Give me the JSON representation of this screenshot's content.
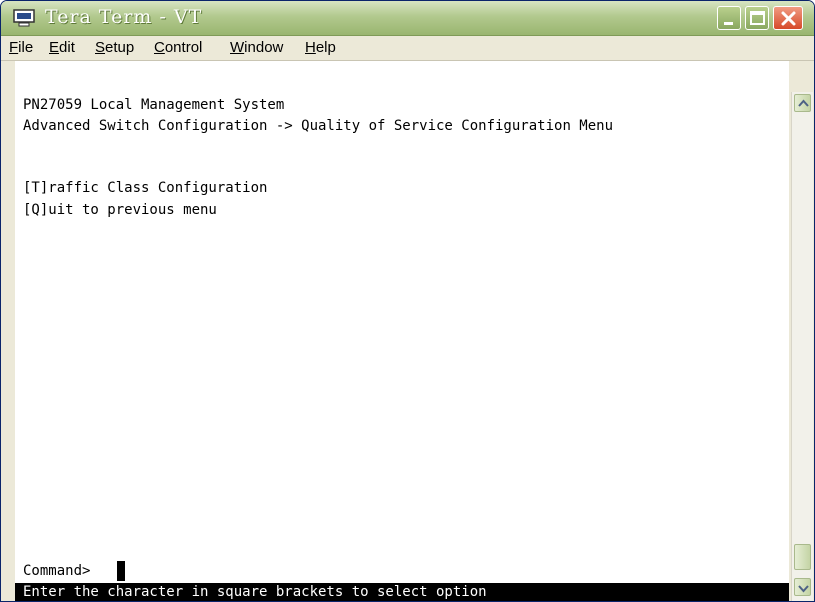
{
  "window": {
    "title": "Tera Term - VT"
  },
  "menu": {
    "items": [
      {
        "label": "File"
      },
      {
        "label": "Edit"
      },
      {
        "label": "Setup"
      },
      {
        "label": "Control"
      },
      {
        "label": "Window"
      },
      {
        "label": "Help"
      }
    ]
  },
  "terminal": {
    "lines": [
      "PN27059 Local Management System",
      "Advanced Switch Configuration -> Quality of Service Configuration Menu",
      "[T]raffic Class Configuration",
      "[Q]uit to previous menu"
    ],
    "prompt": "Command>",
    "status": "Enter the character in square brackets to select option"
  },
  "icons": {
    "app": "terminal-monitor-icon",
    "minimize": "minimize-icon",
    "maximize": "maximize-icon",
    "close": "close-icon",
    "scroll_up": "arrow-up-icon",
    "scroll_down": "arrow-down-icon"
  },
  "colors": {
    "titlebar": "#b2c98e",
    "close_button": "#d64a2a",
    "terminal_bg": "#ffffff",
    "terminal_fg": "#000000",
    "status_bg": "#000000",
    "status_fg": "#ffffff"
  }
}
